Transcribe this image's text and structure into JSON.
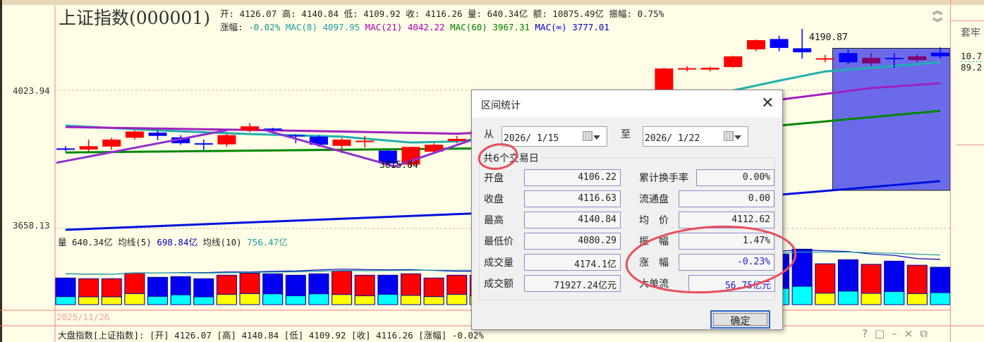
{
  "header": {
    "title": "上证指数(000001)",
    "line1": "开: 4126.07 高: 4140.84 低: 4109.92 收: 4116.26 量: 640.34亿 额: 10875.49亿 振幅: 0.75%",
    "change_label": "涨幅:",
    "change_value": "-0.02%",
    "ma8_label": "MAC(8)",
    "ma8_value": "4097.95",
    "ma21_label": "MAC(21)",
    "ma21_value": "4042.22",
    "ma60_label": "MAC(60)",
    "ma60_value": "3967.31",
    "mainf_label": "MAC(∞)",
    "mainf_value": "3777.01"
  },
  "axis": {
    "p1": "4023.94",
    "p2": "3658.13"
  },
  "annotations": {
    "high_label": "4190.87",
    "low_label": "3815.84"
  },
  "volume_header": {
    "label": "量 640.34亿",
    "ma5_label": "均线(5)",
    "ma5_value": "698.84亿",
    "ma10_label": "均线(10)",
    "ma10_value": "756.47亿"
  },
  "date_label": "2025/11/26",
  "status_bar": "大盘指数[上证指数]: [开] 4126.07 [高] 4140.84 [低] 4109.92 [收] 4116.26 [涨幅] -0.02%",
  "right_panel": {
    "label": "套牢",
    "v1": "10.7",
    "v2": "89.2"
  },
  "colors": {
    "up": "#ff0000",
    "down": "#0000ff",
    "ma8": "#20b0b0",
    "ma21": "#a020c0",
    "ma60": "#008800",
    "mainf": "#0010e0",
    "trend": "#9030d0",
    "selection": "#6b6bea"
  },
  "chart_data": {
    "type": "candlestick",
    "y_axis_ticks": [
      4023.94,
      3658.13
    ],
    "candles": [
      [
        3866,
        3872,
        3858,
        3865
      ],
      [
        3863,
        3890,
        3858,
        3872
      ],
      [
        3871,
        3895,
        3862,
        3890
      ],
      [
        3895,
        3915,
        3890,
        3912
      ],
      [
        3909,
        3915,
        3888,
        3900
      ],
      [
        3896,
        3902,
        3876,
        3880
      ],
      [
        3880,
        3890,
        3862,
        3879
      ],
      [
        3877,
        3906,
        3870,
        3902
      ],
      [
        3915,
        3935,
        3910,
        3926
      ],
      [
        3920,
        3922,
        3914,
        3918
      ],
      [
        3902,
        3905,
        3880,
        3900
      ],
      [
        3898,
        3902,
        3870,
        3876
      ],
      [
        3873,
        3895,
        3853,
        3890
      ],
      [
        3885,
        3900,
        3868,
        3887
      ],
      [
        3860,
        3862,
        3824,
        3825
      ],
      [
        3822,
        3868,
        3815.84,
        3870
      ],
      [
        3857,
        3880,
        3852,
        3876
      ],
      [
        3886,
        3900,
        3880,
        3892
      ],
      [
        3895,
        3920,
        3892,
        3915
      ],
      [
        3915,
        3930,
        3905,
        3925
      ],
      [
        3925,
        3945,
        3915,
        3940
      ],
      [
        3940,
        3955,
        3930,
        3948
      ],
      [
        3948,
        3965,
        3940,
        3960
      ],
      [
        3960,
        3980,
        3955,
        3975
      ],
      [
        3975,
        3995,
        3965,
        3990
      ],
      [
        3990,
        4010,
        3985,
        4005
      ],
      [
        4026,
        4085,
        4020,
        4083
      ],
      [
        4082,
        4090,
        4075,
        4084
      ],
      [
        4080,
        4088,
        4075,
        4085
      ],
      [
        4087,
        4118,
        4085,
        4116
      ],
      [
        4135,
        4162,
        4130,
        4160
      ],
      [
        4163,
        4172,
        4130,
        4139
      ],
      [
        4138,
        4190.87,
        4110,
        4127
      ],
      [
        4110,
        4120,
        4100,
        4111
      ],
      [
        4125,
        4135,
        4095,
        4100
      ],
      [
        4097,
        4125,
        4090,
        4112
      ],
      [
        4112,
        4125,
        4085,
        4111
      ],
      [
        4106,
        4122,
        4100,
        4116
      ],
      [
        4126.07,
        4140.84,
        4109.92,
        4116.26
      ]
    ],
    "volumes": [
      456,
      444,
      444,
      540,
      468,
      480,
      444,
      504,
      540,
      528,
      504,
      528,
      576,
      504,
      504,
      528,
      456,
      504,
      504,
      560,
      600,
      640,
      700,
      720,
      760,
      800,
      860,
      820,
      780,
      840,
      900,
      864,
      950,
      700,
      770,
      690,
      745,
      675,
      640.34
    ],
    "volume_sub_fraction": [
      0.3,
      0.3,
      0.3,
      0.35,
      0.3,
      0.35,
      0.3,
      0.35,
      0.35,
      0.35,
      0.3,
      0.35,
      0.3,
      0.3,
      0.35,
      0.3,
      0.3,
      0.35,
      0.3,
      0.3,
      0.3,
      0.3,
      0.3,
      0.3,
      0.3,
      0.3,
      0.3,
      0.3,
      0.3,
      0.3,
      0.3,
      0.32,
      0.33,
      0.28,
      0.3,
      0.28,
      0.3,
      0.28,
      0.32
    ],
    "ma_lines": {
      "ma8": [
        [
          0,
          3928
        ],
        [
          4,
          3915
        ],
        [
          8,
          3905
        ],
        [
          12,
          3898
        ],
        [
          15,
          3882
        ],
        [
          17,
          3885
        ],
        [
          19,
          3900
        ],
        [
          24,
          3960
        ],
        [
          28,
          4010
        ],
        [
          31,
          4050
        ],
        [
          33,
          4075
        ],
        [
          36,
          4090
        ],
        [
          38,
          4100
        ]
      ],
      "ma21": [
        [
          0,
          3924
        ],
        [
          10,
          3914
        ],
        [
          17,
          3906
        ],
        [
          22,
          3920
        ],
        [
          28,
          3970
        ],
        [
          31,
          3998
        ],
        [
          35,
          4030
        ],
        [
          38,
          4043
        ]
      ],
      "ma60": [
        [
          0,
          3855
        ],
        [
          18,
          3866
        ],
        [
          25,
          3890
        ],
        [
          31,
          3928
        ],
        [
          38,
          3968
        ]
      ],
      "mainf": [
        [
          0,
          3645
        ],
        [
          18,
          3690
        ],
        [
          31,
          3740
        ],
        [
          38,
          3777
        ]
      ]
    },
    "trend_lines": [
      [
        [
          -0.4,
          3827
        ],
        [
          7.05,
          3916
        ]
      ],
      [
        [
          8.64,
          3916
        ],
        [
          14.3,
          3817
        ]
      ],
      [
        [
          14.3,
          3817
        ],
        [
          17.6,
          3888
        ]
      ]
    ],
    "selection": {
      "start": 34,
      "end": 38
    }
  },
  "dialog": {
    "title": "区间统计",
    "from_label": "从",
    "from_value": "2026/  1/15",
    "to_label": "至",
    "to_value": "2026/  1/22",
    "trading_days": "共6个交易日",
    "left": [
      {
        "label": "开盘",
        "value": "4106.22"
      },
      {
        "label": "收盘",
        "value": "4116.63"
      },
      {
        "label": "最高",
        "value": "4140.84"
      },
      {
        "label": "最低价",
        "value": "4080.29"
      },
      {
        "label": "成交量",
        "value": "4174.1亿"
      },
      {
        "label": "成交额",
        "value": "71927.24亿元"
      }
    ],
    "right": [
      {
        "label": "累计换手率",
        "value": "0.00%"
      },
      {
        "label": "流通盘",
        "value": "0.00"
      },
      {
        "label": "均　价",
        "value": "4112.62"
      },
      {
        "label": "振　幅",
        "value": "1.47%"
      },
      {
        "label": "涨　幅",
        "value": "-0.23%"
      },
      {
        "label": "大单流",
        "value": "56.75亿元"
      }
    ],
    "ok_label": "确定"
  }
}
